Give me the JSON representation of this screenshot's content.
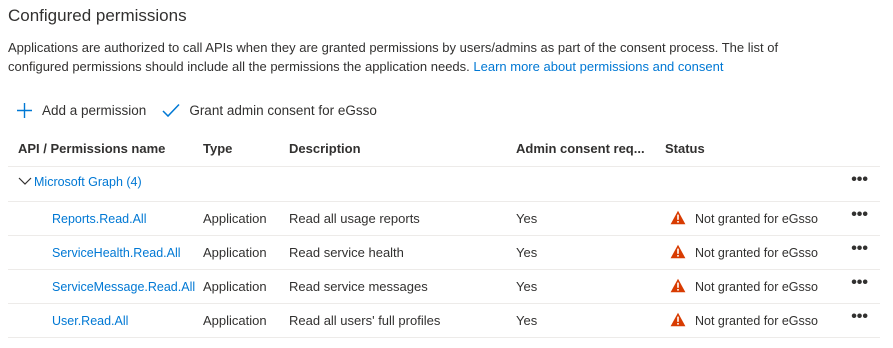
{
  "header": {
    "title": "Configured permissions",
    "description_text": "Applications are authorized to call APIs when they are granted permissions by users/admins as part of the consent process. The list of configured permissions should include all the permissions the application needs. ",
    "learn_more_link": "Learn more about permissions and consent"
  },
  "toolbar": {
    "add_label": "Add a permission",
    "grant_label": "Grant admin consent for eGsso"
  },
  "table": {
    "columns": {
      "name": "API / Permissions name",
      "type": "Type",
      "description": "Description",
      "admin_consent": "Admin consent req...",
      "status": "Status"
    },
    "group": {
      "label": "Microsoft Graph (4)",
      "more": "•••"
    },
    "rows": [
      {
        "name": "Reports.Read.All",
        "type": "Application",
        "description": "Read all usage reports",
        "admin_consent": "Yes",
        "status": "Not granted for eGsso",
        "more": "•••"
      },
      {
        "name": "ServiceHealth.Read.All",
        "type": "Application",
        "description": "Read service health",
        "admin_consent": "Yes",
        "status": "Not granted for eGsso",
        "more": "•••"
      },
      {
        "name": "ServiceMessage.Read.All",
        "type": "Application",
        "description": "Read service messages",
        "admin_consent": "Yes",
        "status": "Not granted for eGsso",
        "more": "•••"
      },
      {
        "name": "User.Read.All",
        "type": "Application",
        "description": "Read all users' full profiles",
        "admin_consent": "Yes",
        "status": "Not granted for eGsso",
        "more": "•••"
      }
    ]
  },
  "colors": {
    "accent": "#0078d4",
    "warning": "#d83b01",
    "text": "#323130",
    "divider": "#edebe9"
  },
  "icons": {
    "add": "plus-icon",
    "grant": "checkmark-icon",
    "group": "chevron-down-icon",
    "status": "warning-icon",
    "more": "more-icon"
  }
}
